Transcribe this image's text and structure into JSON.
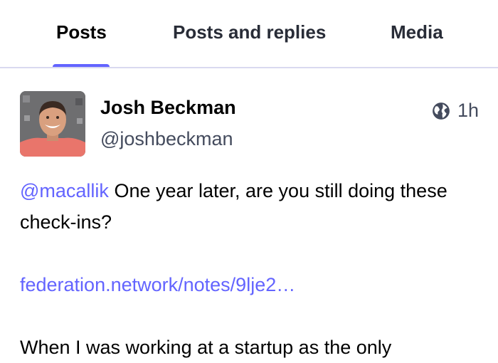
{
  "tabs": [
    {
      "label": "Posts",
      "active": true
    },
    {
      "label": "Posts and replies",
      "active": false
    },
    {
      "label": "Media",
      "active": false
    }
  ],
  "accent_color": "#6364ff",
  "post": {
    "display_name": "Josh Beckman",
    "handle": "@joshbeckman",
    "time": "1h",
    "visibility_icon": "globe-icon",
    "mention": "@macallik",
    "text_1": " One year later, are you still doing these check-ins?",
    "link": "federation.network/notes/9lje2…",
    "text_2": "When I was working at a startup as the only"
  }
}
